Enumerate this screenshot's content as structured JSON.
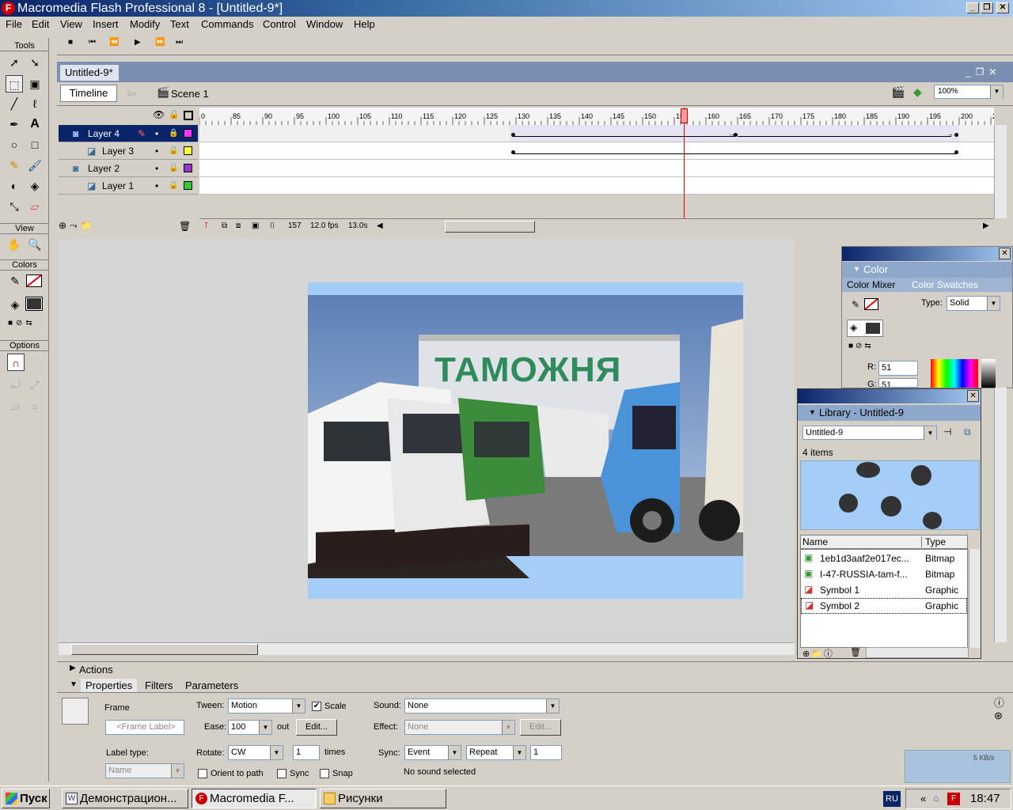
{
  "window": {
    "title": "Macromedia Flash Professional 8 - [Untitled-9*]",
    "logo": "F"
  },
  "menu": [
    "File",
    "Edit",
    "View",
    "Insert",
    "Modify",
    "Text",
    "Commands",
    "Control",
    "Window",
    "Help"
  ],
  "controller": [
    "■",
    "⏮",
    "⏪",
    "▶",
    "⏩",
    "⏭"
  ],
  "tools": {
    "title": "Tools",
    "view": "View",
    "colors": "Colors",
    "options": "Options"
  },
  "document": {
    "tab": "Untitled-9*",
    "timeline_button": "Timeline",
    "scene": "Scene 1",
    "zoom": "100%"
  },
  "timeline": {
    "ruler": [
      "0",
      "85",
      "90",
      "95",
      "100",
      "105",
      "110",
      "115",
      "120",
      "125",
      "130",
      "135",
      "140",
      "145",
      "150",
      "155",
      "160",
      "165",
      "170",
      "175",
      "180",
      "185",
      "190",
      "195",
      "200",
      "20"
    ],
    "layers": [
      {
        "name": "Layer 4",
        "color": "#ff33ff",
        "selected": true
      },
      {
        "name": "Layer 3",
        "color": "#ffff33",
        "selected": false
      },
      {
        "name": "Layer 2",
        "color": "#9933cc",
        "selected": false
      },
      {
        "name": "Layer 1",
        "color": "#33cc33",
        "selected": false
      }
    ],
    "current_frame": "157",
    "fps": "12.0 fps",
    "time": "13.0s"
  },
  "stage": {
    "sign": "ТАМОЖНЯ"
  },
  "actions": {
    "label": "Actions"
  },
  "properties": {
    "tabs": [
      "Properties",
      "Filters",
      "Parameters"
    ],
    "frame_label": "Frame",
    "frame_placeholder": "<Frame Label>",
    "label_type": "Label type:",
    "label_type_value": "Name",
    "tween_label": "Tween:",
    "tween": "Motion",
    "scale": "Scale",
    "ease_label": "Ease:",
    "ease": "100",
    "ease_out": "out",
    "edit": "Edit...",
    "rotate_label": "Rotate:",
    "rotate": "CW",
    "times_value": "1",
    "times": "times",
    "orient": "Orient to path",
    "sync": "Sync",
    "snap": "Snap",
    "sound_label": "Sound:",
    "sound": "None",
    "effect_label": "Effect:",
    "effect": "None",
    "sync_label": "Sync:",
    "sync_value": "Event",
    "repeat": "Repeat",
    "repeat_count": "1",
    "no_sound": "No sound selected"
  },
  "color_panel": {
    "title": "Color",
    "tab1": "Color Mixer",
    "tab2": "Color Swatches",
    "type_label": "Type:",
    "type": "Solid",
    "r_label": "R:",
    "r": "51",
    "g_label": "G:",
    "g": "51"
  },
  "library": {
    "title": "Library - Untitled-9",
    "doc": "Untitled-9",
    "count": "4 items",
    "col_name": "Name",
    "col_type": "Type",
    "items": [
      {
        "name": "1eb1d3aaf2e017ec...",
        "type": "Bitmap"
      },
      {
        "name": "I-47-RUSSIA-tam-f...",
        "type": "Bitmap"
      },
      {
        "name": "Symbol 1",
        "type": "Graphic"
      },
      {
        "name": "Symbol 2",
        "type": "Graphic"
      }
    ]
  },
  "taskbar": {
    "start": "Пуск",
    "tasks": [
      "Демонстрацион...",
      "Macromedia F...",
      "Рисунки"
    ],
    "lang": "RU",
    "clock": "18:47",
    "net": "5 KB/s"
  }
}
